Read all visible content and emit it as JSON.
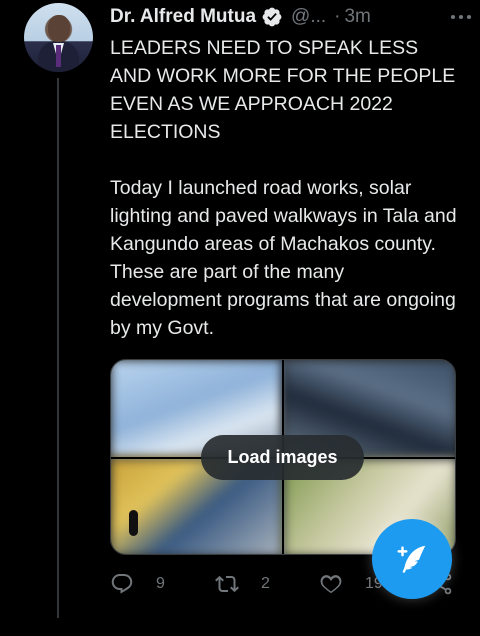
{
  "author": {
    "name": "Dr. Alfred Mutua",
    "handle": "@...",
    "separator": "·",
    "time": "3m"
  },
  "tweet_text": "LEADERS NEED TO SPEAK LESS AND WORK MORE FOR THE PEOPLE EVEN AS WE APPROACH 2022 ELECTIONS\n\nToday I launched road works, solar lighting and paved walkways in Tala and Kangundo areas of Machakos county. These are part of the many development programs that are ongoing by my Govt.",
  "media": {
    "load_label": "Load images"
  },
  "actions": {
    "replies": "9",
    "retweets": "2",
    "likes": "19"
  },
  "icons": {
    "verified": "verified-badge-icon",
    "more": "more-dots-icon",
    "reply": "reply-icon",
    "retweet": "retweet-icon",
    "like": "heart-icon",
    "share": "share-icon",
    "compose": "compose-feather-icon"
  },
  "colors": {
    "accent": "#1d9bf0",
    "background": "#000000",
    "secondary_text": "#71767b"
  }
}
